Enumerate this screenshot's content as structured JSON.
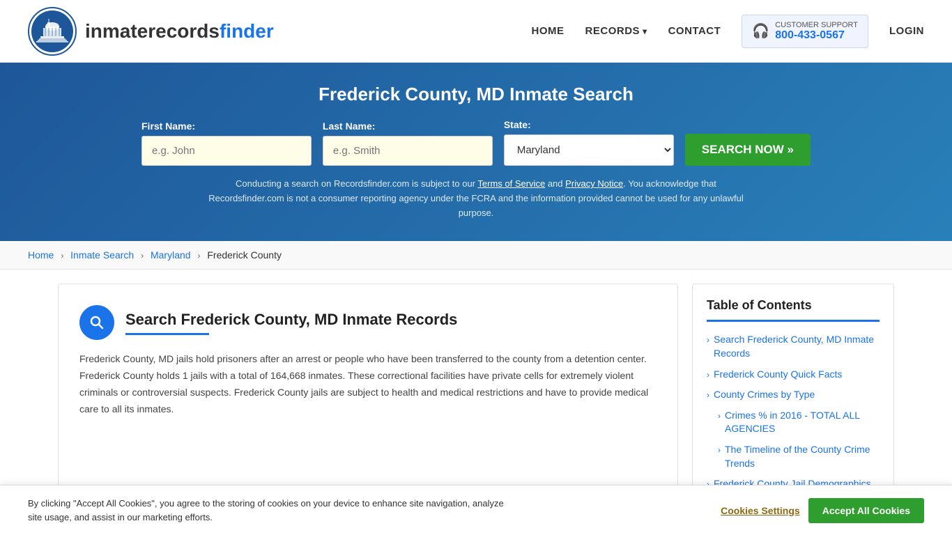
{
  "header": {
    "logo_text_normal": "inmaterecords",
    "logo_text_bold": "finder",
    "nav": {
      "home": "HOME",
      "records": "RECORDS",
      "contact": "CONTACT",
      "login": "LOGIN"
    },
    "support": {
      "label": "CUSTOMER SUPPORT",
      "number": "800-433-0567"
    }
  },
  "hero": {
    "title": "Frederick County, MD Inmate Search",
    "form": {
      "first_name_label": "First Name:",
      "first_name_placeholder": "e.g. John",
      "last_name_label": "Last Name:",
      "last_name_placeholder": "e.g. Smith",
      "state_label": "State:",
      "state_value": "Maryland",
      "search_button": "SEARCH NOW »"
    },
    "disclaimer": "Conducting a search on Recordsfinder.com is subject to our Terms of Service and Privacy Notice. You acknowledge that Recordsfinder.com is not a consumer reporting agency under the FCRA and the information provided cannot be used for any unlawful purpose."
  },
  "breadcrumb": {
    "home": "Home",
    "inmate_search": "Inmate Search",
    "maryland": "Maryland",
    "current": "Frederick County"
  },
  "content": {
    "section_title": "Search Frederick County, MD Inmate Records",
    "body": "Frederick County, MD jails hold prisoners after an arrest or people who have been transferred to the county from a detention center. Frederick County holds 1 jails with a total of 164,668 inmates. These correctional facilities have private cells for extremely violent criminals or controversial suspects. Frederick County jails are subject to health and medical restrictions and have to provide medical care to all its inmates."
  },
  "toc": {
    "title": "Table of Contents",
    "items": [
      {
        "label": "Search Frederick County, MD Inmate Records",
        "sub": false
      },
      {
        "label": "Frederick County Quick Facts",
        "sub": false
      },
      {
        "label": "County Crimes by Type",
        "sub": false
      },
      {
        "label": "Crimes % in 2016 - TOTAL ALL AGENCIES",
        "sub": true
      },
      {
        "label": "The Timeline of the County Crime Trends",
        "sub": true
      },
      {
        "label": "Frederick County Jail Demographics",
        "sub": false
      }
    ]
  },
  "cookie_banner": {
    "text": "By clicking \"Accept All Cookies\", you agree to the storing of cookies on your device to enhance site navigation, analyze site usage, and assist in our marketing efforts.",
    "settings_label": "Cookies Settings",
    "accept_label": "Accept All Cookies"
  }
}
